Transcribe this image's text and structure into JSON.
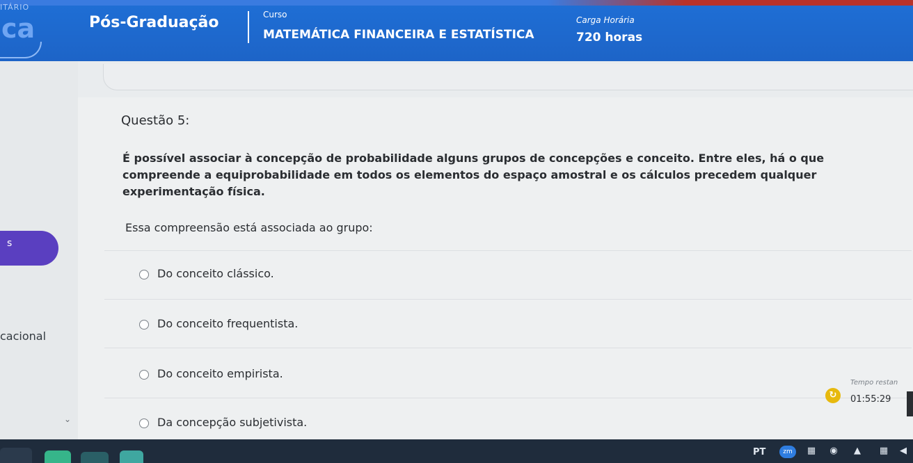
{
  "header": {
    "fragment_top": "ITÁRIO",
    "fragment_big": "ca",
    "program": "Pós-Graduação",
    "course_label": "Curso",
    "course_name": "MATEMÁTICA FINANCEIRA E ESTATÍSTICA",
    "hours_label": "Carga Horária",
    "hours_value": "720 horas"
  },
  "sidebar": {
    "pill_text": "s",
    "partial_text": "cacional"
  },
  "question": {
    "title": "Questão 5:",
    "body": "É possível associar à concepção de probabilidade alguns grupos de concepções e conceito. Entre eles, há o que compreende a equiprobabilidade em todos os elementos do espaço amostral e os cálculos precedem qualquer experimentação física.",
    "prompt": "Essa compreensão está associada ao grupo:",
    "options": [
      {
        "label": "Do conceito clássico."
      },
      {
        "label": "Do conceito frequentista."
      },
      {
        "label": "Do conceito empirista."
      },
      {
        "label": "Da concepção subjetivista."
      }
    ]
  },
  "timer": {
    "label": "Tempo restan",
    "value": "01:55:29",
    "icon": "clock-refresh-icon",
    "color": "#e7b90e"
  },
  "taskbar": {
    "lang": "PT",
    "badge": "zm",
    "icons": [
      "calendar-icon",
      "chrome-icon",
      "wifi-icon",
      "network-icon",
      "volume-icon"
    ]
  },
  "colors": {
    "header_blue": "#1f6fd6",
    "accent_purple": "#5a3fc0",
    "taskbar": "#1f2c3c"
  }
}
